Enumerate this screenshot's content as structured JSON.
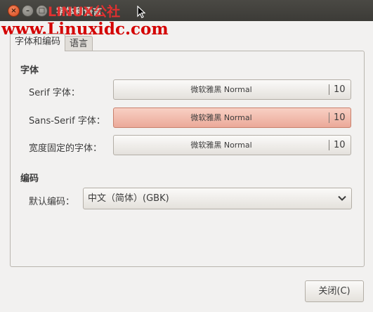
{
  "window": {
    "title": "字体和语言",
    "watermark_logo": "LINUX公社",
    "watermark_url": "www.Linuxidc.com"
  },
  "tabs": [
    {
      "label": "字体和编码",
      "active": true
    },
    {
      "label": "语言",
      "active": false
    }
  ],
  "fonts": {
    "heading": "字体",
    "rows": [
      {
        "label": "Serif 字体：",
        "font": "微软雅黑 Normal",
        "size": "10"
      },
      {
        "label": "Sans-Serif 字体：",
        "font": "微软雅黑 Normal",
        "size": "10"
      },
      {
        "label": "宽度固定的字体：",
        "font": "微软雅黑 Normal",
        "size": "10"
      }
    ]
  },
  "encoding": {
    "heading": "编码",
    "label": "默认编码：",
    "value": "中文（简体）(GBK)"
  },
  "footer": {
    "close_label": "关闭(C)"
  },
  "colors": {
    "titlebar": "#3c3b37",
    "highlight_button": "#eba999",
    "watermark": "#d40000"
  }
}
